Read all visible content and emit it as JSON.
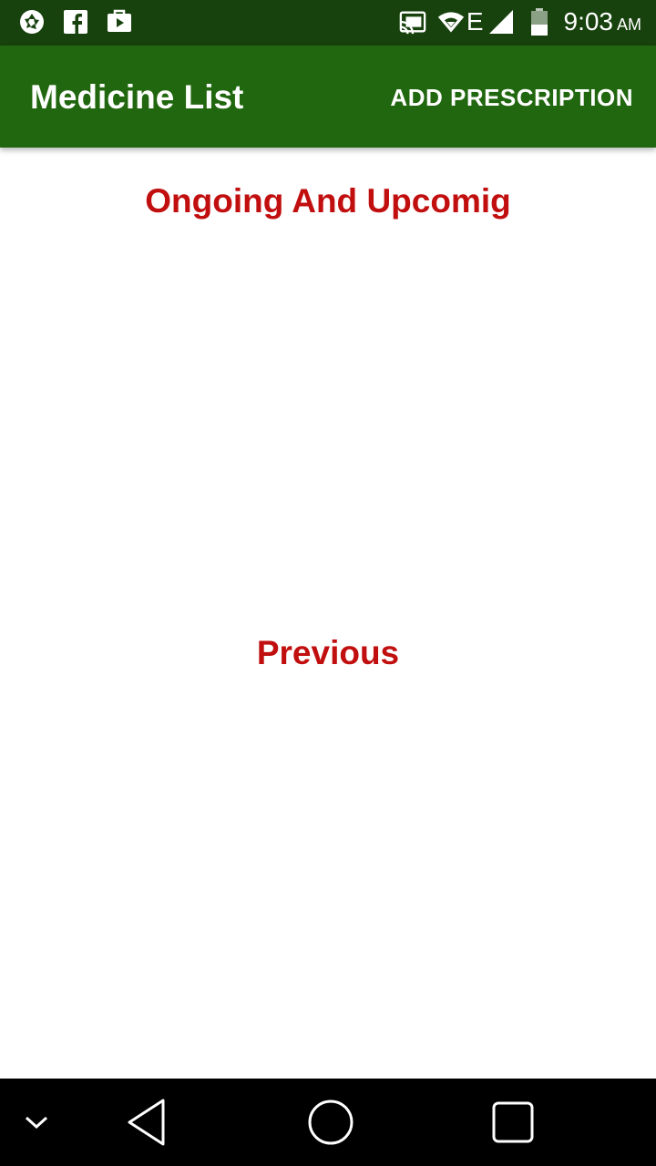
{
  "status_bar": {
    "left_icons": [
      "aperture-icon",
      "facebook-icon",
      "media-bag-icon"
    ],
    "right_icons": [
      "cast-icon",
      "wifi-icon",
      "network-type-e",
      "signal-icon",
      "battery-icon"
    ],
    "network_type": "E",
    "time": "9:03",
    "ampm": "AM"
  },
  "app_bar": {
    "title": "Medicine List",
    "action_label": "ADD PRESCRIPTION",
    "color": "#21670f"
  },
  "sections": {
    "ongoing_title": "Ongoing And Upcomig",
    "previous_title": "Previous",
    "title_color": "#c10e0e"
  },
  "nav_bar": {
    "icons": [
      "chevron-down-icon",
      "back-icon",
      "home-icon",
      "recents-icon"
    ]
  }
}
